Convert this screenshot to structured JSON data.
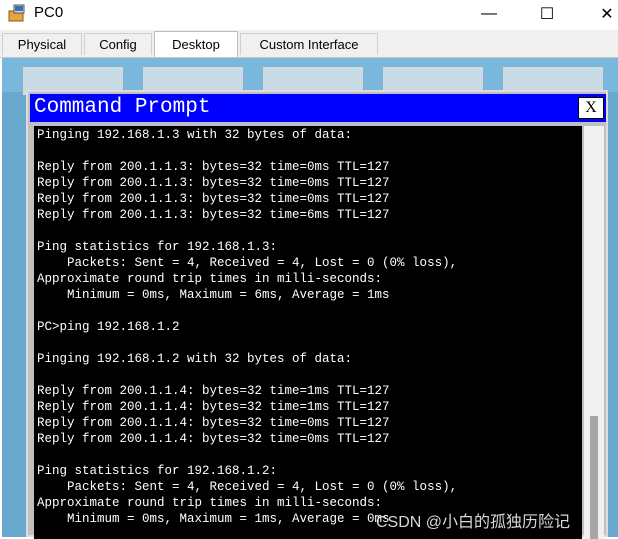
{
  "window": {
    "title": "PC0",
    "app_icon": "pc-device-icon"
  },
  "controls": {
    "minimize": "—",
    "maximize": "☐",
    "close": "✕"
  },
  "tabs": [
    {
      "label": "Physical"
    },
    {
      "label": "Config"
    },
    {
      "label": "Desktop"
    },
    {
      "label": "Custom Interface"
    }
  ],
  "active_tab": "Desktop",
  "command_prompt": {
    "title": "Command Prompt",
    "close_label": "X",
    "lines": [
      "Pinging 192.168.1.3 with 32 bytes of data:",
      "",
      "Reply from 200.1.1.3: bytes=32 time=0ms TTL=127",
      "Reply from 200.1.1.3: bytes=32 time=0ms TTL=127",
      "Reply from 200.1.1.3: bytes=32 time=0ms TTL=127",
      "Reply from 200.1.1.3: bytes=32 time=6ms TTL=127",
      "",
      "Ping statistics for 192.168.1.3:",
      "    Packets: Sent = 4, Received = 4, Lost = 0 (0% loss),",
      "Approximate round trip times in milli-seconds:",
      "    Minimum = 0ms, Maximum = 6ms, Average = 1ms",
      "",
      "PC>ping 192.168.1.2",
      "",
      "Pinging 192.168.1.2 with 32 bytes of data:",
      "",
      "Reply from 200.1.1.4: bytes=32 time=1ms TTL=127",
      "Reply from 200.1.1.4: bytes=32 time=1ms TTL=127",
      "Reply from 200.1.1.4: bytes=32 time=0ms TTL=127",
      "Reply from 200.1.1.4: bytes=32 time=0ms TTL=127",
      "",
      "Ping statistics for 192.168.1.2:",
      "    Packets: Sent = 4, Received = 4, Lost = 0 (0% loss),",
      "Approximate round trip times in milli-seconds:",
      "    Minimum = 0ms, Maximum = 1ms, Average = 0ms"
    ]
  },
  "watermark": "CSDN @小白的孤独历险记",
  "colors": {
    "cmd_header": "#0000ff",
    "terminal_bg": "#000000",
    "terminal_text": "#ffffff",
    "desktop_bg": "#6aa9cf"
  }
}
